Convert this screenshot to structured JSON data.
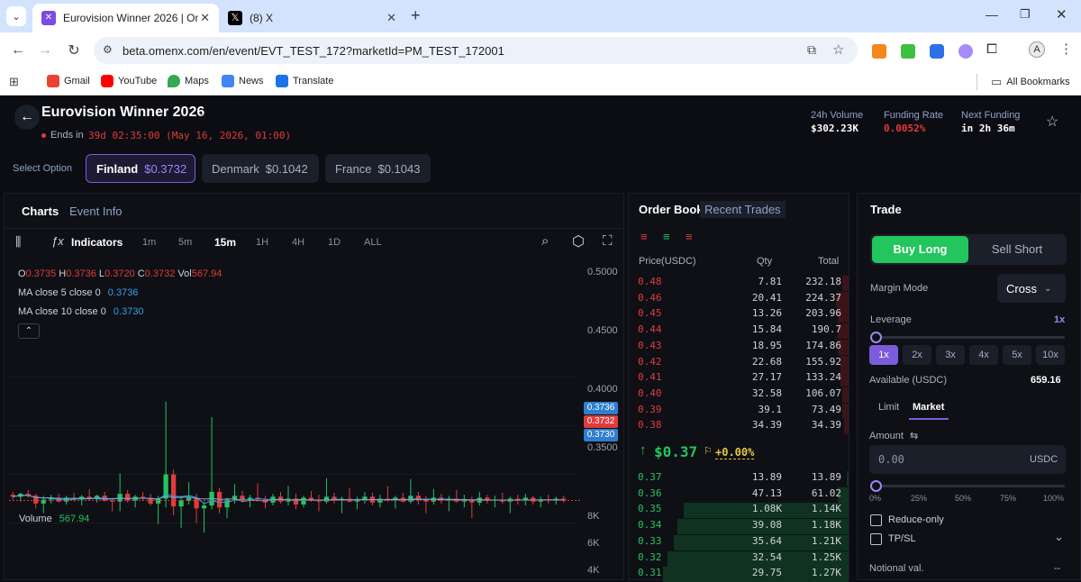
{
  "browser": {
    "tabs": [
      {
        "title": "Eurovision Winner 2026 | Omen",
        "active": true
      },
      {
        "title": "(8) X",
        "active": false
      }
    ],
    "url": "beta.omenx.com/en/event/EVT_TEST_172?marketId=PM_TEST_172001",
    "bookmarks": [
      "Gmail",
      "YouTube",
      "Maps",
      "News",
      "Translate"
    ],
    "all_bookmarks": "All Bookmarks",
    "profile_initial": "A"
  },
  "header": {
    "title": "Eurovision Winner 2026",
    "ends_label": "Ends in",
    "ends_value": "39d 02:35:00 (May 16, 2026, 01:00)",
    "stats": [
      {
        "label": "24h Volume",
        "value": "$302.23K"
      },
      {
        "label": "Funding Rate",
        "value": "0.0052%"
      },
      {
        "label": "Next Funding",
        "value": "in 2h 36m"
      }
    ]
  },
  "options": {
    "label": "Select Option",
    "items": [
      {
        "name": "Finland",
        "price": "$0.3732",
        "selected": true
      },
      {
        "name": "Denmark",
        "price": "$0.1042",
        "selected": false
      },
      {
        "name": "France",
        "price": "$0.1043",
        "selected": false
      }
    ]
  },
  "chart_panel": {
    "tabs": [
      "Charts",
      "Event Info"
    ],
    "indicators_label": "Indicators",
    "timeframes": [
      "1m",
      "5m",
      "15m",
      "1H",
      "4H",
      "1D",
      "ALL"
    ],
    "active_timeframe": "15m",
    "ohlc": {
      "o": "0.3735",
      "h": "0.3736",
      "l": "0.3720",
      "c": "0.3732",
      "vol": "567.94"
    },
    "ma5_label": "MA close 5 close 0",
    "ma5_value": "0.3736",
    "ma10_label": "MA close 10 close 0",
    "ma10_value": "0.3730",
    "volume_label": "Volume",
    "volume_value": "567.94"
  },
  "chart_data": {
    "type": "candlestick",
    "title": "",
    "ylim": [
      0.33,
      0.51
    ],
    "y_ticks": [
      "0.5000",
      "0.4500",
      "0.4000",
      "0.3500"
    ],
    "price_tags": [
      {
        "value": "0.3736",
        "color": "#2f7fd0"
      },
      {
        "value": "0.3732",
        "color": "#e23b3b"
      },
      {
        "value": "0.3730",
        "color": "#2f7fd0"
      }
    ],
    "volume_ticks": [
      "8K",
      "6K",
      "4K"
    ],
    "volume_ylim": [
      0,
      9000
    ],
    "candles": [
      [
        0.379,
        0.382,
        0.374,
        0.377
      ],
      [
        0.377,
        0.381,
        0.372,
        0.38
      ],
      [
        0.38,
        0.384,
        0.376,
        0.378
      ],
      [
        0.378,
        0.38,
        0.365,
        0.37
      ],
      [
        0.37,
        0.378,
        0.36,
        0.374
      ],
      [
        0.374,
        0.379,
        0.37,
        0.376
      ],
      [
        0.376,
        0.38,
        0.371,
        0.372
      ],
      [
        0.372,
        0.378,
        0.369,
        0.376
      ],
      [
        0.376,
        0.381,
        0.372,
        0.374
      ],
      [
        0.374,
        0.379,
        0.368,
        0.377
      ],
      [
        0.377,
        0.385,
        0.373,
        0.375
      ],
      [
        0.375,
        0.379,
        0.371,
        0.378
      ],
      [
        0.378,
        0.382,
        0.372,
        0.373
      ],
      [
        0.373,
        0.376,
        0.362,
        0.372
      ],
      [
        0.372,
        0.401,
        0.362,
        0.38
      ],
      [
        0.38,
        0.384,
        0.371,
        0.373
      ],
      [
        0.373,
        0.379,
        0.366,
        0.377
      ],
      [
        0.377,
        0.382,
        0.373,
        0.376
      ],
      [
        0.376,
        0.38,
        0.368,
        0.37
      ],
      [
        0.37,
        0.378,
        0.349,
        0.375
      ],
      [
        0.375,
        0.475,
        0.366,
        0.4
      ],
      [
        0.4,
        0.405,
        0.358,
        0.367
      ],
      [
        0.367,
        0.378,
        0.345,
        0.373
      ],
      [
        0.373,
        0.392,
        0.369,
        0.376
      ],
      [
        0.376,
        0.38,
        0.35,
        0.365
      ],
      [
        0.365,
        0.372,
        0.34,
        0.368
      ],
      [
        0.368,
        0.459,
        0.364,
        0.382
      ],
      [
        0.382,
        0.386,
        0.36,
        0.366
      ],
      [
        0.366,
        0.376,
        0.355,
        0.374
      ],
      [
        0.374,
        0.39,
        0.37,
        0.378
      ],
      [
        0.378,
        0.383,
        0.371,
        0.373
      ],
      [
        0.373,
        0.379,
        0.366,
        0.376
      ],
      [
        0.376,
        0.391,
        0.372,
        0.374
      ],
      [
        0.374,
        0.378,
        0.365,
        0.371
      ],
      [
        0.371,
        0.38,
        0.368,
        0.377
      ],
      [
        0.377,
        0.382,
        0.37,
        0.372
      ],
      [
        0.372,
        0.388,
        0.368,
        0.375
      ],
      [
        0.375,
        0.38,
        0.364,
        0.369
      ],
      [
        0.369,
        0.378,
        0.366,
        0.376
      ],
      [
        0.376,
        0.383,
        0.372,
        0.374
      ],
      [
        0.374,
        0.379,
        0.362,
        0.372
      ],
      [
        0.372,
        0.396,
        0.37,
        0.377
      ],
      [
        0.377,
        0.381,
        0.37,
        0.373
      ],
      [
        0.373,
        0.377,
        0.36,
        0.375
      ],
      [
        0.375,
        0.386,
        0.371,
        0.372
      ],
      [
        0.372,
        0.377,
        0.364,
        0.374
      ],
      [
        0.374,
        0.382,
        0.37,
        0.377
      ],
      [
        0.377,
        0.381,
        0.368,
        0.371
      ],
      [
        0.371,
        0.379,
        0.366,
        0.375
      ],
      [
        0.375,
        0.388,
        0.372,
        0.373
      ],
      [
        0.373,
        0.378,
        0.365,
        0.376
      ],
      [
        0.376,
        0.381,
        0.371,
        0.372
      ],
      [
        0.372,
        0.395,
        0.37,
        0.378
      ],
      [
        0.378,
        0.382,
        0.369,
        0.374
      ],
      [
        0.374,
        0.378,
        0.36,
        0.372
      ],
      [
        0.372,
        0.385,
        0.369,
        0.376
      ],
      [
        0.376,
        0.38,
        0.37,
        0.373
      ],
      [
        0.373,
        0.378,
        0.362,
        0.375
      ],
      [
        0.375,
        0.384,
        0.371,
        0.372
      ],
      [
        0.372,
        0.379,
        0.366,
        0.374
      ],
      [
        0.374,
        0.377,
        0.355,
        0.371
      ],
      [
        0.371,
        0.382,
        0.368,
        0.376
      ],
      [
        0.376,
        0.379,
        0.37,
        0.373
      ],
      [
        0.373,
        0.378,
        0.366,
        0.374
      ],
      [
        0.374,
        0.381,
        0.37,
        0.372
      ],
      [
        0.372,
        0.377,
        0.36,
        0.375
      ],
      [
        0.375,
        0.379,
        0.369,
        0.373
      ],
      [
        0.373,
        0.38,
        0.368,
        0.376
      ],
      [
        0.376,
        0.378,
        0.369,
        0.372
      ],
      [
        0.372,
        0.377,
        0.366,
        0.374
      ],
      [
        0.374,
        0.379,
        0.37,
        0.373
      ],
      [
        0.373,
        0.377,
        0.369,
        0.375
      ],
      [
        0.375,
        0.378,
        0.371,
        0.3732
      ]
    ],
    "volumes": [
      1200,
      900,
      1500,
      2100,
      1800,
      1100,
      900,
      1300,
      1000,
      1600,
      2200,
      1200,
      1000,
      1900,
      3400,
      1500,
      1200,
      1100,
      1400,
      2600,
      6800,
      2400,
      2000,
      1500,
      1800,
      2700,
      7600,
      2600,
      1800,
      1400,
      1200,
      1100,
      1300,
      1200,
      1000,
      1100,
      1500,
      1300,
      1100,
      900,
      1200,
      2600,
      1100,
      1500,
      1800,
      1200,
      1100,
      1300,
      1000,
      1700,
      1100,
      1200,
      3800,
      1400,
      1600,
      1300,
      1000,
      1500,
      1200,
      1100,
      1800,
      1300,
      1000,
      1200,
      1100,
      1400,
      900,
      1000,
      1100,
      1200,
      900,
      800,
      567.94
    ]
  },
  "orderbook": {
    "tabs": [
      "Order Book",
      "Recent Trades"
    ],
    "headers": [
      "Price(USDC)",
      "Qty",
      "Total"
    ],
    "asks": [
      {
        "price": "0.48",
        "qty": "7.81",
        "total": "232.18"
      },
      {
        "price": "0.46",
        "qty": "20.41",
        "total": "224.37"
      },
      {
        "price": "0.45",
        "qty": "13.26",
        "total": "203.96"
      },
      {
        "price": "0.44",
        "qty": "15.84",
        "total": "190.7"
      },
      {
        "price": "0.43",
        "qty": "18.95",
        "total": "174.86"
      },
      {
        "price": "0.42",
        "qty": "22.68",
        "total": "155.92"
      },
      {
        "price": "0.41",
        "qty": "27.17",
        "total": "133.24"
      },
      {
        "price": "0.40",
        "qty": "32.58",
        "total": "106.07"
      },
      {
        "price": "0.39",
        "qty": "39.1",
        "total": "73.49"
      },
      {
        "price": "0.38",
        "qty": "34.39",
        "total": "34.39"
      }
    ],
    "ask_depth": [
      0.03,
      0.06,
      0.05,
      0.05,
      0.05,
      0.04,
      0.04,
      0.03,
      0.03,
      0.02
    ],
    "last_price": "$0.37",
    "change": "+0.00%",
    "bids": [
      {
        "price": "0.37",
        "qty": "13.89",
        "total": "13.89"
      },
      {
        "price": "0.36",
        "qty": "47.13",
        "total": "61.02"
      },
      {
        "price": "0.35",
        "qty": "1.08K",
        "total": "1.14K"
      },
      {
        "price": "0.34",
        "qty": "39.08",
        "total": "1.18K"
      },
      {
        "price": "0.33",
        "qty": "35.64",
        "total": "1.21K"
      },
      {
        "price": "0.32",
        "qty": "32.54",
        "total": "1.25K"
      },
      {
        "price": "0.31",
        "qty": "29.75",
        "total": "1.27K"
      }
    ],
    "bid_depth": [
      0.01,
      0.05,
      0.78,
      0.81,
      0.83,
      0.86,
      0.88
    ]
  },
  "trade": {
    "title": "Trade",
    "buy_label": "Buy Long",
    "sell_label": "Sell Short",
    "margin_mode_label": "Margin Mode",
    "margin_mode_value": "Cross",
    "leverage_label": "Leverage",
    "leverage_value": "1x",
    "leverage_options": [
      "1x",
      "2x",
      "3x",
      "4x",
      "5x",
      "10x"
    ],
    "available_label": "Available (USDC)",
    "available_value": "659.16",
    "order_types": [
      "Limit",
      "Market"
    ],
    "active_order_type": "Market",
    "amount_label": "Amount",
    "amount_placeholder": "0.00",
    "amount_unit": "USDC",
    "percent_marks": [
      "0%",
      "25%",
      "50%",
      "75%",
      "100%"
    ],
    "reduce_only": "Reduce-only",
    "tpsl": "TP/SL",
    "notional_label": "Notional val.",
    "notional_value": "--"
  },
  "colors": {
    "green": "#22c55e",
    "red": "#e23b3b",
    "accent": "#7c5cdb",
    "blue": "#3b9be8"
  }
}
